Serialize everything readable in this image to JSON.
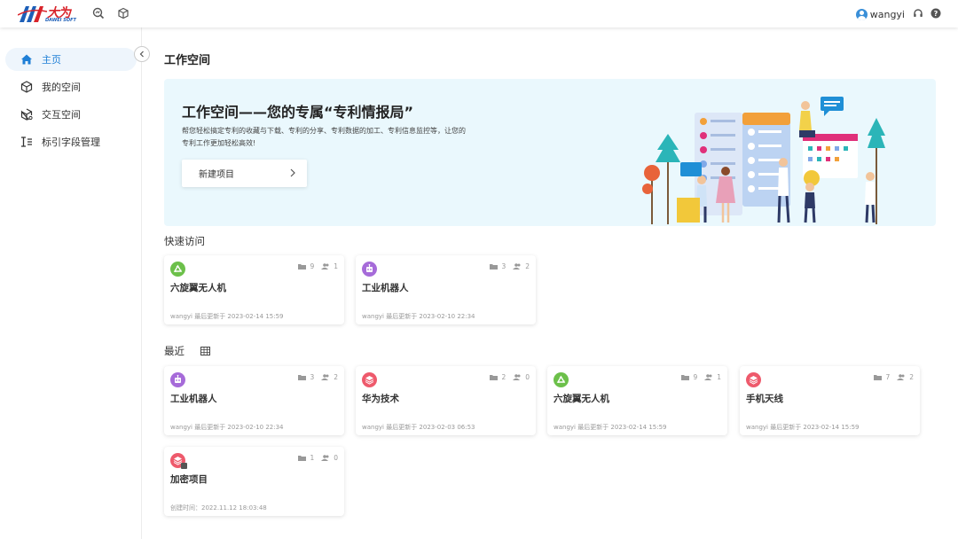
{
  "logo": {
    "cn": "大为",
    "en": "DAWEI SOFT"
  },
  "header": {
    "username": "wangyi"
  },
  "sidebar": {
    "items": [
      {
        "label": "主页",
        "active": true
      },
      {
        "label": "我的空间"
      },
      {
        "label": "交互空间"
      },
      {
        "label": "标引字段管理"
      }
    ]
  },
  "main": {
    "title": "工作空间",
    "banner": {
      "title": "工作空间——您的专属“专利情报局”",
      "desc": "帮您轻松搞定专利的收藏与下载、专利的分享、专利数据的加工、专利信息监控等，让您的专利工作更加轻松高效!",
      "button": "新建项目"
    },
    "quick": {
      "title": "快速访问",
      "cards": [
        {
          "name": "六旋翼无人机",
          "folders": "9",
          "members": "1",
          "meta": "wangyi 最后更新于 2023-02-14 15:59",
          "icon": "recycle-icon",
          "color": "#6cc04a"
        },
        {
          "name": "工业机器人",
          "folders": "3",
          "members": "2",
          "meta": "wangyi 最后更新于 2023-02-10 22:34",
          "icon": "robot-icon",
          "color": "#a66bd9"
        }
      ]
    },
    "recent": {
      "title": "最近",
      "cards": [
        {
          "name": "工业机器人",
          "folders": "3",
          "members": "2",
          "meta": "wangyi 最后更新于 2023-02-10 22:34",
          "icon": "robot-icon",
          "color": "#a66bd9"
        },
        {
          "name": "华为技术",
          "folders": "2",
          "members": "0",
          "meta": "wangyi 最后更新于 2023-02-03 06:53",
          "icon": "layers-icon",
          "color": "#ee5a6c"
        },
        {
          "name": "六旋翼无人机",
          "folders": "9",
          "members": "1",
          "meta": "wangyi 最后更新于 2023-02-14 15:59",
          "icon": "recycle-icon",
          "color": "#6cc04a"
        },
        {
          "name": "手机天线",
          "folders": "7",
          "members": "2",
          "meta": "wangyi 最后更新于 2023-02-14 15:59",
          "icon": "layers-icon",
          "color": "#ee5a6c"
        },
        {
          "name": "加密项目",
          "folders": "1",
          "members": "0",
          "meta": "创建时间：2022.11.12 18:03:48",
          "icon": "layers-lock-icon",
          "color": "#ee5a6c"
        }
      ]
    }
  },
  "colors": {
    "accent": "#1f7fd6",
    "banner_bg": "#eaf8fd"
  }
}
